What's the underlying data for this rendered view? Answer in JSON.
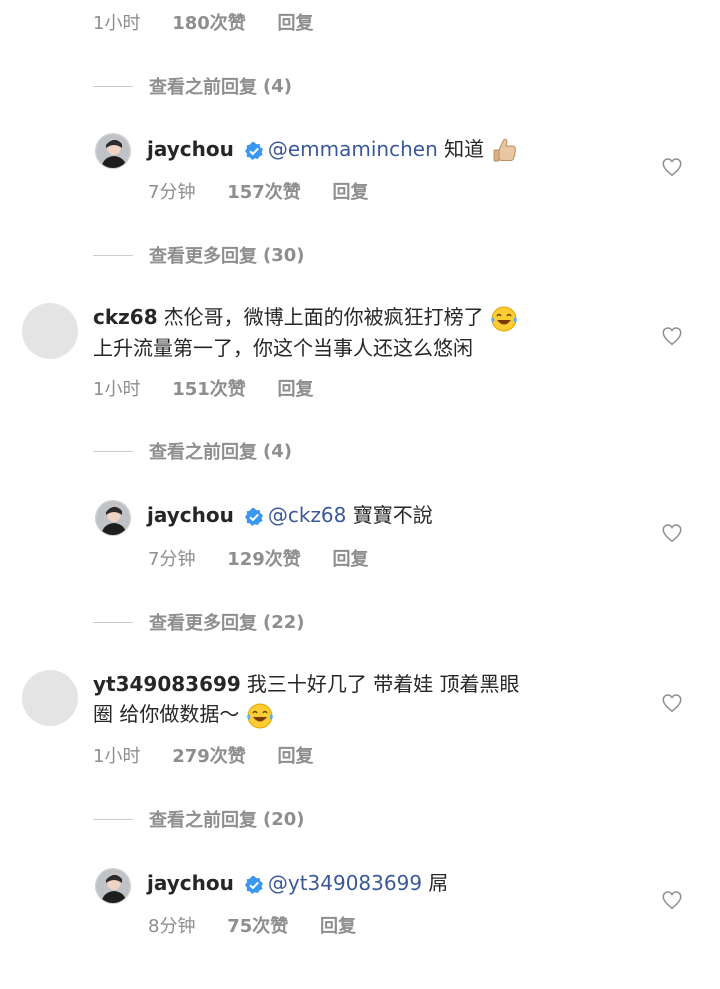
{
  "icons": {
    "heart": "heart-outline-icon",
    "verified": "verified-badge-icon",
    "laughing": "face-with-tears-of-joy-emoji",
    "thumbs": "thumbs-up-emoji"
  },
  "colors": {
    "mention": "#3b5998",
    "meta": "#8e8e8e",
    "verified": "#3897f0"
  },
  "top": {
    "time": "1小时",
    "likes": "180次赞",
    "reply": "回复"
  },
  "threads": [
    {
      "view_label": "查看之前回复",
      "view_count": "(4)",
      "reply": {
        "username": "jaychou",
        "mention": "@emmaminchen",
        "text": "知道",
        "time": "7分钟",
        "likes": "157次赞",
        "reply_label": "回复"
      },
      "more_label": "查看更多回复",
      "more_count": "(30)"
    },
    {
      "comment": {
        "username": "ckz68",
        "line1": "杰伦哥，微博上面的你被疯狂打榜了",
        "line2": "上升流量第一了，你这个当事人还这么悠闲",
        "time": "1小时",
        "likes": "151次赞",
        "reply_label": "回复"
      },
      "view_label": "查看之前回复",
      "view_count": "(4)",
      "reply": {
        "username": "jaychou",
        "mention": "@ckz68",
        "text": "寶寶不說",
        "time": "7分钟",
        "likes": "129次赞",
        "reply_label": "回复"
      },
      "more_label": "查看更多回复",
      "more_count": "(22)"
    },
    {
      "comment": {
        "username": "yt349083699",
        "line1": "我三十好几了 带着娃 顶着黑眼",
        "line2": "圈 给你做数据～",
        "time": "1小时",
        "likes": "279次赞",
        "reply_label": "回复"
      },
      "view_label": "查看之前回复",
      "view_count": "(20)",
      "reply": {
        "username": "jaychou",
        "mention": "@yt349083699",
        "text": "屌",
        "time": "8分钟",
        "likes": "75次赞",
        "reply_label": "回复"
      }
    }
  ]
}
